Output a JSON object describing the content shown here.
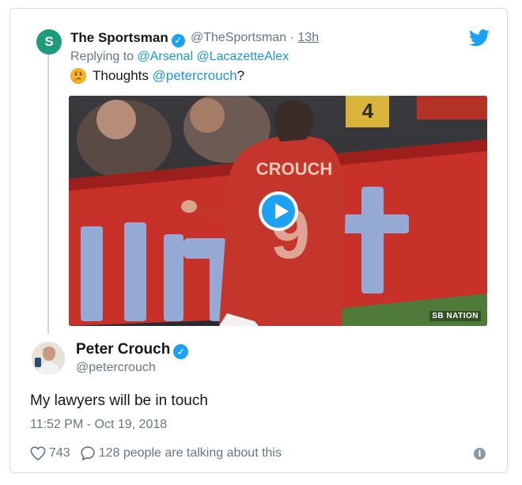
{
  "reply_tweet": {
    "avatar_letter": "S",
    "avatar_color": "#1e9b7a",
    "name": "The Sportsman",
    "handle": "@TheSportsman",
    "separator": "·",
    "time": "13h",
    "replying_prefix": "Replying to",
    "replying_to": [
      "@Arsenal",
      "@LacazetteAlex"
    ],
    "text_prefix": "Thoughts",
    "text_mention": "@petercrouch",
    "text_suffix": "?",
    "media": {
      "shirt_name": "CROUCH",
      "shirt_number": "9",
      "watermark": "SB NATION",
      "board_number": "4",
      "board_letters": "vin t"
    }
  },
  "main_tweet": {
    "name": "Peter Crouch",
    "handle": "@petercrouch",
    "text": "My lawyers will be in touch",
    "timestamp": "11:52 PM - Oct 19, 2018",
    "likes": "743",
    "comments": "128 people are talking about this"
  },
  "colors": {
    "link": "#1b95e0",
    "verified": "#1da1f2",
    "twitter": "#1da1f2",
    "muted": "#657786"
  }
}
